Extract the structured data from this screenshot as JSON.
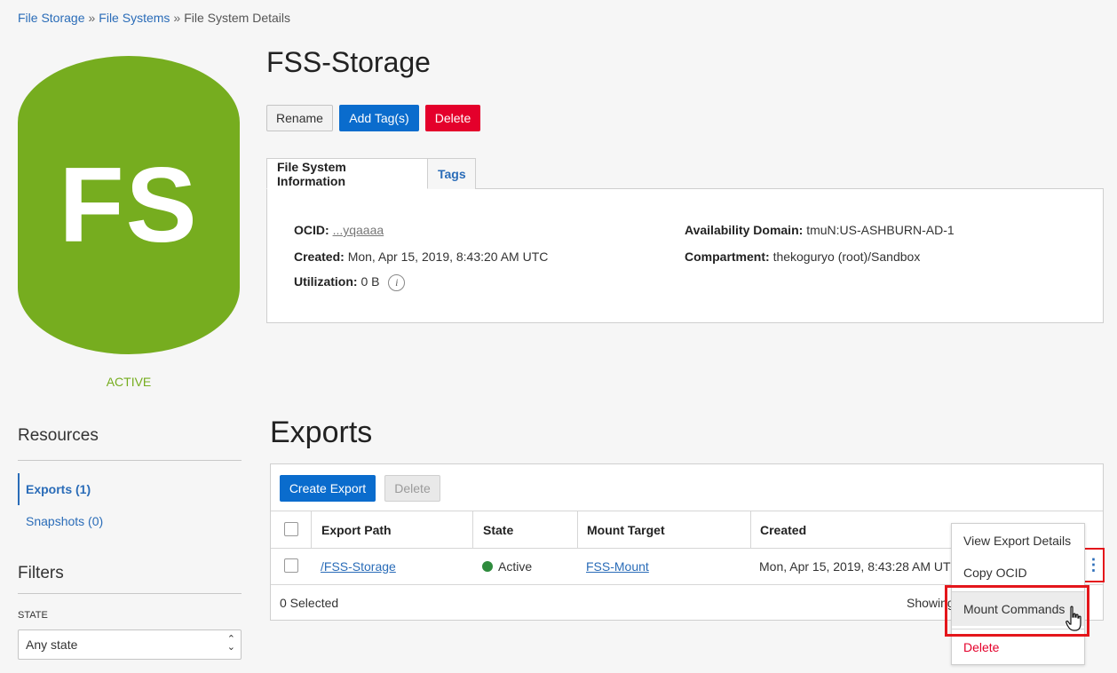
{
  "breadcrumb": {
    "items": [
      "File Storage",
      "File Systems",
      "File System Details"
    ],
    "separator": "»"
  },
  "resource": {
    "icon_text": "FS",
    "status": "ACTIVE",
    "title": "FSS-Storage"
  },
  "actions": {
    "rename": "Rename",
    "add_tags": "Add Tag(s)",
    "delete": "Delete"
  },
  "tabs": [
    {
      "label": "File System Information",
      "active": true
    },
    {
      "label": "Tags",
      "active": false
    }
  ],
  "info": {
    "ocid_label": "OCID:",
    "ocid_value": "...yqaaaa",
    "created_label": "Created:",
    "created_value": "Mon, Apr 15, 2019, 8:43:20 AM UTC",
    "utilization_label": "Utilization:",
    "utilization_value": "0 B",
    "availability_domain_label": "Availability Domain:",
    "availability_domain_value": "tmuN:US-ASHBURN-AD-1",
    "compartment_label": "Compartment:",
    "compartment_value": "thekoguryo (root)/Sandbox"
  },
  "sidebar": {
    "resources_heading": "Resources",
    "items": [
      {
        "label": "Exports (1)",
        "active": true
      },
      {
        "label": "Snapshots (0)",
        "active": false
      }
    ],
    "filters_heading": "Filters",
    "state_label": "STATE",
    "state_value": "Any state"
  },
  "exports": {
    "title": "Exports",
    "create_button": "Create Export",
    "delete_button": "Delete",
    "columns": [
      "Export Path",
      "State",
      "Mount Target",
      "Created"
    ],
    "rows": [
      {
        "export_path": "/FSS-Storage",
        "state": "Active",
        "mount_target": "FSS-Mount",
        "created": "Mon, Apr 15, 2019, 8:43:28 AM UTC"
      }
    ],
    "footer_selected": "0 Selected",
    "footer_showing": "Showing"
  },
  "context_menu": {
    "items": [
      "View Export Details",
      "Copy OCID",
      "Mount Commands",
      "Delete"
    ],
    "hovered": "Mount Commands"
  },
  "colors": {
    "brand_green": "#76ad1f",
    "link_blue": "#2a6cb8",
    "primary_blue": "#0a6ccd",
    "danger_red": "#e4002b",
    "highlight_red": "#e4161b"
  },
  "icons": [
    "info-icon",
    "kebab-menu-icon",
    "chevron-updown-icon",
    "hand-cursor-icon",
    "status-dot-icon"
  ]
}
